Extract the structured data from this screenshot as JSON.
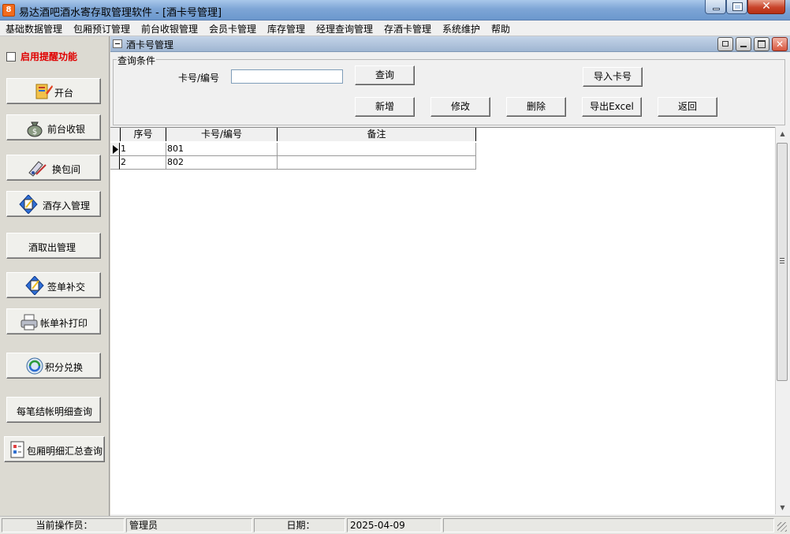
{
  "window": {
    "title": "易达酒吧酒水寄存取管理软件 - [酒卡号管理]",
    "icon_text": "8",
    "close_glyph": "✕"
  },
  "menu": [
    "基础数据管理",
    "包厢预订管理",
    "前台收银管理",
    "会员卡管理",
    "库存管理",
    "经理查询管理",
    "存酒卡管理",
    "系统维护",
    "帮助"
  ],
  "sidebar": {
    "reminder_label": "启用提醒功能",
    "reminder_checked": false,
    "buttons": [
      {
        "label": "开台",
        "icon": "open-table-icon"
      },
      {
        "label": "前台收银",
        "icon": "money-bag-icon"
      },
      {
        "label": "换包间",
        "icon": "change-room-icon"
      },
      {
        "label": "酒存入管理",
        "icon": "wine-deposit-icon"
      },
      {
        "label": "酒取出管理",
        "icon": ""
      },
      {
        "label": "签单补交",
        "icon": "sign-bill-icon"
      },
      {
        "label": "帐单补打印",
        "icon": "printer-icon"
      },
      {
        "label": "积分兑换",
        "icon": "points-exchange-icon"
      },
      {
        "label": "每笔结帐明细查询",
        "icon": ""
      },
      {
        "label": "包厢明细汇总查询",
        "icon": "room-summary-icon"
      }
    ]
  },
  "child_window": {
    "title": "酒卡号管理",
    "close_glyph": "✕"
  },
  "query": {
    "legend": "查询条件",
    "card_label": "卡号/编号",
    "card_value": "",
    "card_placeholder": "",
    "buttons": {
      "search": "查询",
      "import": "导入卡号",
      "add": "新增",
      "edit": "修改",
      "delete": "删除",
      "export": "导出Excel",
      "back": "返回"
    }
  },
  "grid": {
    "columns": [
      "序号",
      "卡号/编号",
      "备注"
    ],
    "rows": [
      [
        "1",
        "801",
        ""
      ],
      [
        "2",
        "802",
        ""
      ]
    ]
  },
  "statusbar": {
    "operator_label": "当前操作员：",
    "operator_value": "管理员",
    "date_label": "日期：",
    "date_value": "2025-04-09"
  }
}
